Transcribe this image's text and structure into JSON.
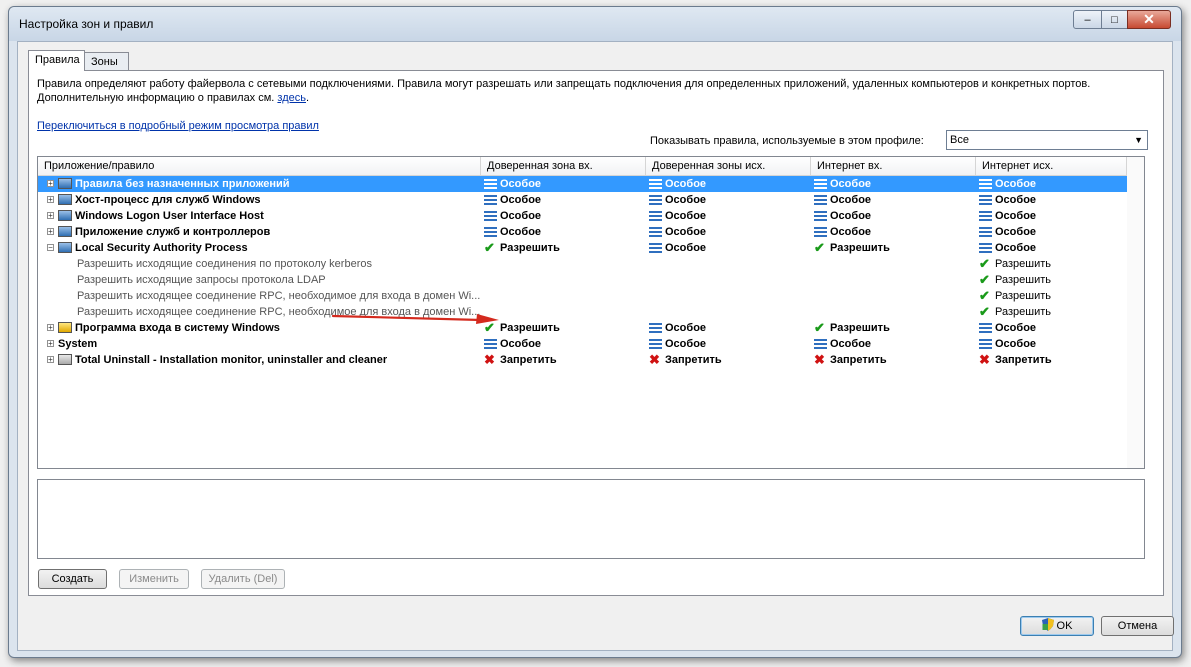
{
  "window": {
    "title": "Настройка зон и правил",
    "controls": {
      "min": "–",
      "max": "□",
      "close": "✕"
    }
  },
  "tabs": [
    {
      "label": "Правила",
      "active": true
    },
    {
      "label": "Зоны",
      "active": false
    }
  ],
  "description": {
    "line1": "Правила определяют работу файервола с сетевыми подключениями. Правила могут разрешать или запрещать подключения для определенных приложений, удаленных компьютеров и конкретных портов.",
    "line2": "Дополнительную информацию о правилах см.",
    "link": "здесь",
    "after_link": "."
  },
  "switch_link": "Переключиться в подробный режим просмотра правил",
  "profile": {
    "label": "Показывать правила, используемые в этом профиле:",
    "value": "Все"
  },
  "grid": {
    "columns": [
      "Приложение/правило",
      "Доверенная зона вх.",
      "Доверенная зоны исх.",
      "Интернет вх.",
      "Интернет исх."
    ],
    "rows": [
      {
        "name": "Правила без назначенных приложений",
        "level": 0,
        "selected": true,
        "icon": "app-window-icon",
        "cells": [
          {
            "t": "Особое",
            "k": "special"
          },
          {
            "t": "Особое",
            "k": "special"
          },
          {
            "t": "Особое",
            "k": "special"
          },
          {
            "t": "Особое",
            "k": "special"
          }
        ]
      },
      {
        "name": "Хост-процесс для служб Windows",
        "level": 0,
        "icon": "app-window-icon",
        "cells": [
          {
            "t": "Особое",
            "k": "special"
          },
          {
            "t": "Особое",
            "k": "special"
          },
          {
            "t": "Особое",
            "k": "special"
          },
          {
            "t": "Особое",
            "k": "special"
          }
        ]
      },
      {
        "name": "Windows Logon User Interface Host",
        "level": 0,
        "icon": "app-window-icon",
        "cells": [
          {
            "t": "Особое",
            "k": "special"
          },
          {
            "t": "Особое",
            "k": "special"
          },
          {
            "t": "Особое",
            "k": "special"
          },
          {
            "t": "Особое",
            "k": "special"
          }
        ]
      },
      {
        "name": "Приложение служб и контроллеров",
        "level": 0,
        "icon": "app-window-icon",
        "cells": [
          {
            "t": "Особое",
            "k": "special"
          },
          {
            "t": "Особое",
            "k": "special"
          },
          {
            "t": "Особое",
            "k": "special"
          },
          {
            "t": "Особое",
            "k": "special"
          }
        ]
      },
      {
        "name": "Local Security Authority Process",
        "level": 0,
        "expanded": true,
        "icon": "app-window-icon",
        "cells": [
          {
            "t": "Разрешить",
            "k": "allow"
          },
          {
            "t": "Особое",
            "k": "special"
          },
          {
            "t": "Разрешить",
            "k": "allow"
          },
          {
            "t": "Особое",
            "k": "special"
          }
        ]
      },
      {
        "name": "Разрешить исходящие соединения по протоколу kerberos",
        "level": 1,
        "cells": [
          {
            "t": "",
            "k": ""
          },
          {
            "t": "",
            "k": ""
          },
          {
            "t": "",
            "k": ""
          },
          {
            "t": "Разрешить",
            "k": "allow"
          }
        ]
      },
      {
        "name": "Разрешить исходящие запросы протокола LDAP",
        "level": 1,
        "cells": [
          {
            "t": "",
            "k": ""
          },
          {
            "t": "",
            "k": ""
          },
          {
            "t": "",
            "k": ""
          },
          {
            "t": "Разрешить",
            "k": "allow"
          }
        ]
      },
      {
        "name": "Разрешить исходящее соединение RPC, необходимое для входа в домен Wi...",
        "level": 1,
        "cells": [
          {
            "t": "",
            "k": ""
          },
          {
            "t": "",
            "k": ""
          },
          {
            "t": "",
            "k": ""
          },
          {
            "t": "Разрешить",
            "k": "allow"
          }
        ]
      },
      {
        "name": "Разрешить исходящее соединение RPC, необходимое для входа в домен Wi...",
        "level": 1,
        "cells": [
          {
            "t": "",
            "k": ""
          },
          {
            "t": "",
            "k": ""
          },
          {
            "t": "",
            "k": ""
          },
          {
            "t": "Разрешить",
            "k": "allow"
          }
        ]
      },
      {
        "name": "Программа входа в систему Windows",
        "level": 0,
        "icon": "winlogon-icon",
        "cells": [
          {
            "t": "Разрешить",
            "k": "allow"
          },
          {
            "t": "Особое",
            "k": "special"
          },
          {
            "t": "Разрешить",
            "k": "allow"
          },
          {
            "t": "Особое",
            "k": "special"
          }
        ]
      },
      {
        "name": "System",
        "level": 0,
        "noicon": true,
        "cells": [
          {
            "t": "Особое",
            "k": "special"
          },
          {
            "t": "Особое",
            "k": "special"
          },
          {
            "t": "Особое",
            "k": "special"
          },
          {
            "t": "Особое",
            "k": "special"
          }
        ]
      },
      {
        "name": "Total Uninstall - Installation monitor, uninstaller and cleaner",
        "level": 0,
        "icon": "uninstaller-icon",
        "cells": [
          {
            "t": "Запретить",
            "k": "deny"
          },
          {
            "t": "Запретить",
            "k": "deny"
          },
          {
            "t": "Запретить",
            "k": "deny"
          },
          {
            "t": "Запретить",
            "k": "deny"
          }
        ]
      }
    ]
  },
  "buttons": {
    "create": "Создать",
    "edit": "Изменить",
    "delete": "Удалить (Del)",
    "ok": "OK",
    "cancel": "Отмена"
  },
  "colors": {
    "selection": "#3399ff",
    "allow": "#1a9a1a",
    "deny": "#d01212",
    "special": "#2f6fbf",
    "arrow": "#d42a1e"
  }
}
